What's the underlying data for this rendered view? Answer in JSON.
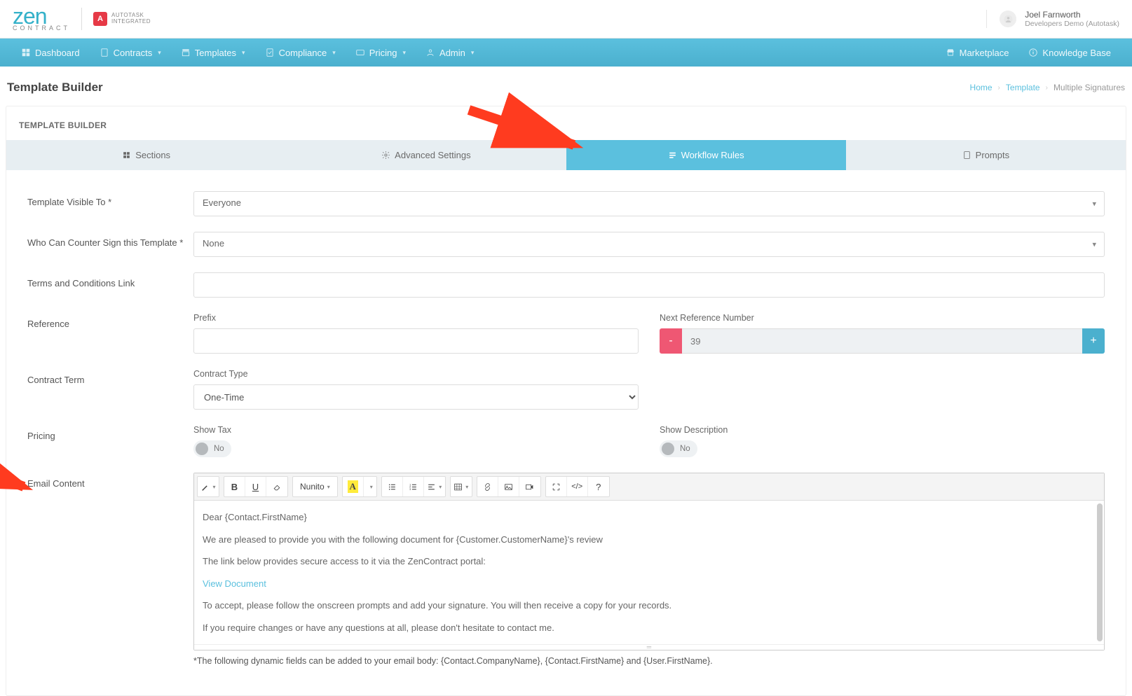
{
  "header": {
    "logo_main": "zen",
    "logo_sub": "CONTRACT",
    "autotask_line1": "AUTOTASK",
    "autotask_line2": "INTEGRATED",
    "user_name": "Joel Farnworth",
    "user_company": "Developers Demo (Autotask)"
  },
  "nav": {
    "dashboard": "Dashboard",
    "contracts": "Contracts",
    "templates": "Templates",
    "compliance": "Compliance",
    "pricing": "Pricing",
    "admin": "Admin",
    "marketplace": "Marketplace",
    "knowledge_base": "Knowledge Base"
  },
  "page": {
    "title": "Template Builder",
    "bc_home": "Home",
    "bc_template": "Template",
    "bc_current": "Multiple Signatures"
  },
  "card": {
    "header": "TEMPLATE BUILDER",
    "tabs": {
      "sections": "Sections",
      "advanced": "Advanced Settings",
      "workflow": "Workflow Rules",
      "prompts": "Prompts"
    }
  },
  "form": {
    "visible_to_label": "Template Visible To *",
    "visible_to_value": "Everyone",
    "counter_sign_label": "Who Can Counter Sign this Template *",
    "counter_sign_value": "None",
    "terms_label": "Terms and Conditions Link",
    "terms_value": "",
    "reference_label": "Reference",
    "prefix_label": "Prefix",
    "prefix_value": "",
    "next_ref_label": "Next Reference Number",
    "next_ref_value": "39",
    "contract_term_label": "Contract Term",
    "contract_type_label": "Contract Type",
    "contract_type_value": "One-Time",
    "pricing_label": "Pricing",
    "show_tax_label": "Show Tax",
    "show_tax_value": "No",
    "show_desc_label": "Show Description",
    "show_desc_value": "No",
    "email_content_label": "Email Content",
    "font_name": "Nunito",
    "email_line1": "Dear {Contact.FirstName}",
    "email_line2": "We are pleased to provide you with the following document for {Customer.CustomerName}'s review",
    "email_line3": "The link below provides secure access to it via the ZenContract portal:",
    "email_link": "View Document",
    "email_line4": "To accept, please follow the onscreen prompts and add your signature. You will then receive a copy for your records.",
    "email_line5": "If you require changes or have any questions at all, please don't hesitate to contact me.",
    "footnote": "*The following dynamic fields can be added to your email body: {Contact.CompanyName}, {Contact.FirstName} and {User.FirstName}."
  }
}
